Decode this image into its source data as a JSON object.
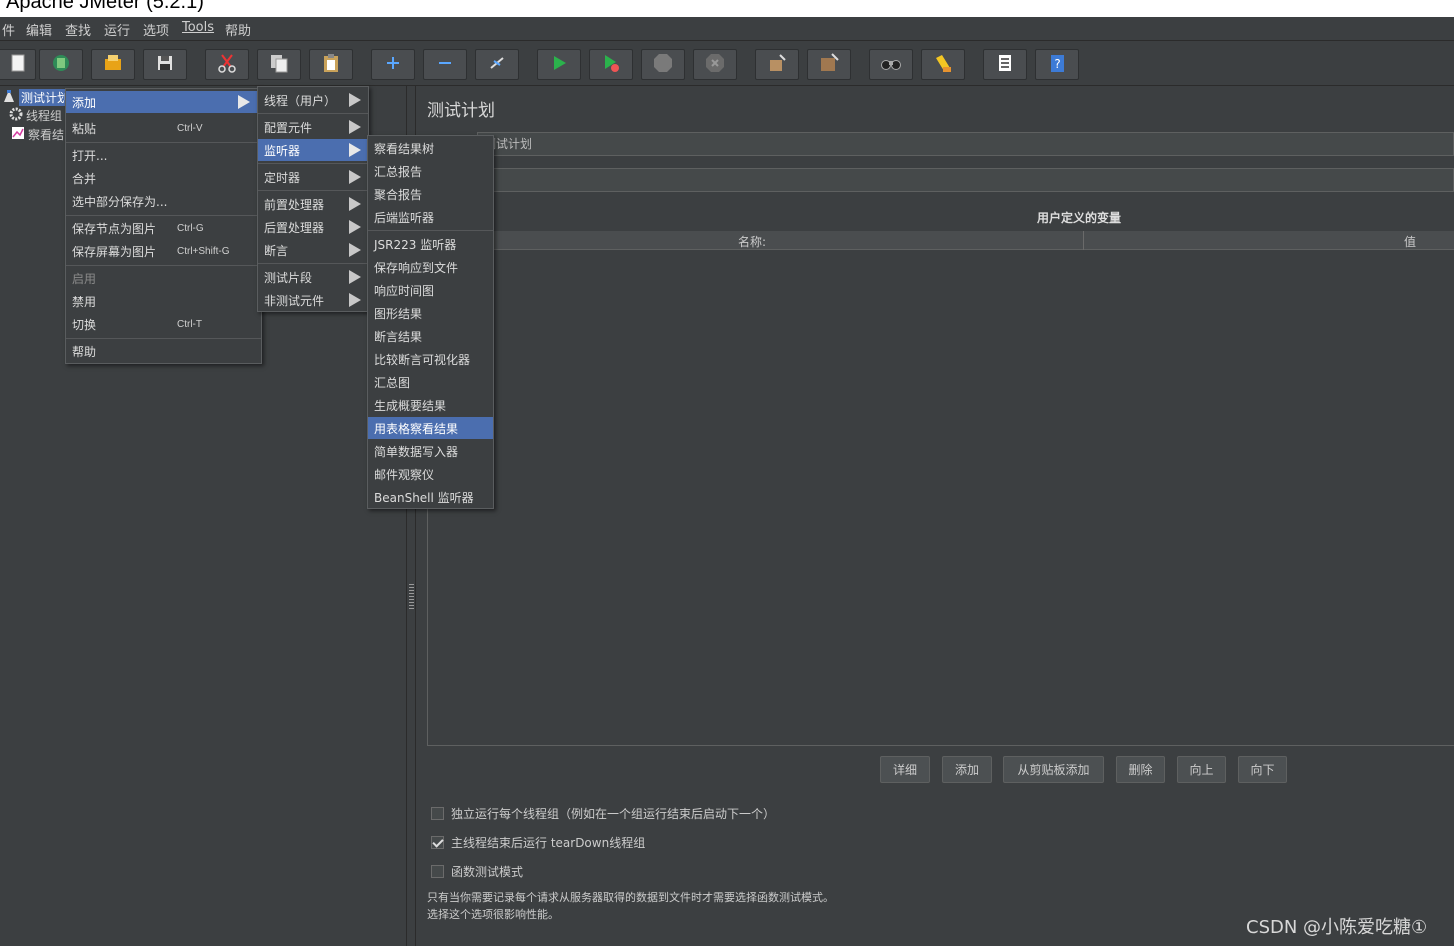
{
  "window": {
    "title": "Apache JMeter (5.2.1)"
  },
  "menubar": [
    "件",
    "编辑",
    "查找",
    "运行",
    "选项",
    "Tools",
    "帮助"
  ],
  "toolbar": {
    "icons": [
      "new-icon",
      "templates-icon",
      "open-icon",
      "save-icon",
      "cut-icon",
      "copy-icon",
      "paste-icon",
      "expand-icon",
      "collapse-icon",
      "toggle-icon",
      "start-icon",
      "start-no-pause-icon",
      "stop-icon",
      "shutdown-icon",
      "clear-icon",
      "clear-all-icon",
      "search-icon",
      "reset-search-icon",
      "function-helper-icon",
      "help-icon"
    ]
  },
  "tree": {
    "items": [
      {
        "label": "测试计划",
        "icon": "test-plan-icon",
        "selected": true
      },
      {
        "label": "线程组",
        "icon": "gear-icon"
      },
      {
        "label": "察看结",
        "icon": "graph-icon"
      }
    ]
  },
  "context_menu": {
    "items": [
      {
        "label": "添加",
        "shortcut": "",
        "highlighted": true,
        "submenu": true
      },
      {
        "label": "粘贴",
        "shortcut": "Ctrl-V"
      },
      {
        "label": "打开...",
        "shortcut": ""
      },
      {
        "label": "合并",
        "shortcut": ""
      },
      {
        "label": "选中部分保存为...",
        "shortcut": ""
      },
      {
        "label": "保存节点为图片",
        "shortcut": "Ctrl-G"
      },
      {
        "label": "保存屏幕为图片",
        "shortcut": "Ctrl+Shift-G"
      },
      {
        "label": "启用",
        "shortcut": "",
        "disabled": true
      },
      {
        "label": "禁用",
        "shortcut": ""
      },
      {
        "label": "切换",
        "shortcut": "Ctrl-T"
      },
      {
        "label": "帮助",
        "shortcut": ""
      }
    ]
  },
  "add_submenu": {
    "items": [
      {
        "label": "线程（用户）"
      },
      {
        "label": "配置元件"
      },
      {
        "label": "监听器",
        "highlighted": true
      },
      {
        "label": "定时器"
      },
      {
        "label": "前置处理器"
      },
      {
        "label": "后置处理器"
      },
      {
        "label": "断言"
      },
      {
        "label": "测试片段"
      },
      {
        "label": "非测试元件"
      }
    ]
  },
  "listener_submenu": {
    "items": [
      {
        "label": "察看结果树"
      },
      {
        "label": "汇总报告"
      },
      {
        "label": "聚合报告"
      },
      {
        "label": "后端监听器"
      },
      {
        "label": "JSR223 监听器"
      },
      {
        "label": "保存响应到文件"
      },
      {
        "label": "响应时间图"
      },
      {
        "label": "图形结果"
      },
      {
        "label": "断言结果"
      },
      {
        "label": "比较断言可视化器"
      },
      {
        "label": "汇总图"
      },
      {
        "label": "生成概要结果"
      },
      {
        "label": "用表格察看结果",
        "highlighted": true
      },
      {
        "label": "简单数据写入器"
      },
      {
        "label": "邮件观察仪"
      },
      {
        "label": "BeanShell 监听器"
      }
    ]
  },
  "panel": {
    "title": "测试计划",
    "name_value": "测试计划",
    "comment_value": "",
    "table_title": "用户定义的变量",
    "columns": [
      "名称:",
      "值"
    ],
    "buttons": [
      "详细",
      "添加",
      "从剪贴板添加",
      "删除",
      "向上",
      "向下"
    ],
    "checkboxes": [
      {
        "label": "独立运行每个线程组（例如在一个组运行结束后启动下一个）",
        "checked": false
      },
      {
        "label": "主线程结束后运行 tearDown线程组",
        "checked": true
      },
      {
        "label": "函数测试模式",
        "checked": false
      }
    ],
    "note_lines": [
      "只有当你需要记录每个请求从服务器取得的数据到文件时才需要选择函数测试模式。",
      "选择这个选项很影响性能。"
    ]
  },
  "watermark": "CSDN @小陈爱吃糖①",
  "colors": {
    "background": "#3c3f41",
    "highlight": "#4b6eaf",
    "field": "#45494a"
  }
}
